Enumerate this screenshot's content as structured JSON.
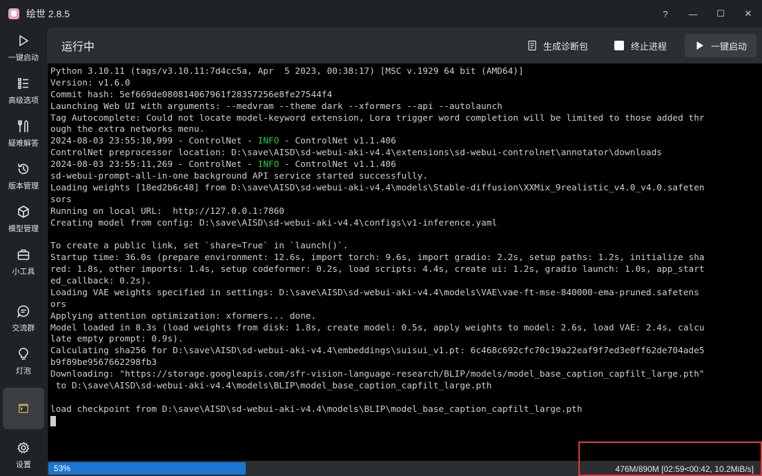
{
  "window": {
    "title": "绘世 2.8.5",
    "controls": [
      "?",
      "—",
      "☐",
      "✕"
    ]
  },
  "sidebar": {
    "items": [
      {
        "label": "一键启动",
        "icon": "play-icon"
      },
      {
        "label": "高级选项",
        "icon": "list-icon"
      },
      {
        "label": "疑难解答",
        "icon": "tools-icon"
      },
      {
        "label": "版本管理",
        "icon": "history-icon"
      },
      {
        "label": "模型管理",
        "icon": "cube-icon"
      },
      {
        "label": "小工具",
        "icon": "toolbox-icon"
      },
      {
        "label": "交流群",
        "icon": "chat-icon"
      },
      {
        "label": "灯泡",
        "icon": "bulb-icon"
      },
      {
        "label": "",
        "icon": "console-icon",
        "active": true
      },
      {
        "label": "设置",
        "icon": "gear-icon"
      }
    ]
  },
  "header": {
    "title": "运行中",
    "diagnose_label": "生成诊断包",
    "terminate_label": "终止进程",
    "launch_label": "一键启动"
  },
  "console": {
    "lines": [
      "Python 3.10.11 (tags/v3.10.11:7d4cc5a, Apr  5 2023, 00:38:17) [MSC v.1929 64 bit (AMD64)]",
      "Version: v1.6.0",
      "Commit hash: 5ef669de080814067961f28357256e8fe27544f4",
      "Launching Web UI with arguments: --medvram --theme dark --xformers --api --autolaunch",
      "Tag Autocomplete: Could not locate model-keyword extension, Lora trigger word completion will be limited to those added thr",
      "ough the extra networks menu.",
      "2024-08-03 23:55:10,999 - ControlNet - INFO - ControlNet v1.1.406",
      "ControlNet preprocessor location: D:\\save\\AISD\\sd-webui-aki-v4.4\\extensions\\sd-webui-controlnet\\annotator\\downloads",
      "2024-08-03 23:55:11,269 - ControlNet - INFO - ControlNet v1.1.406",
      "sd-webui-prompt-all-in-one background API service started successfully.",
      "Loading weights [18ed2b6c48] from D:\\save\\AISD\\sd-webui-aki-v4.4\\models\\Stable-diffusion\\XXMix_9realistic_v4.0_v4.0.safeten",
      "sors",
      "Running on local URL:  http://127.0.0.1:7860",
      "Creating model from config: D:\\save\\AISD\\sd-webui-aki-v4.4\\configs\\v1-inference.yaml",
      "",
      "To create a public link, set `share=True` in `launch()`.",
      "Startup time: 36.0s (prepare environment: 12.6s, import torch: 9.6s, import gradio: 2.2s, setup paths: 1.2s, initialize sha",
      "red: 1.8s, other imports: 1.4s, setup codeformer: 0.2s, load scripts: 4.4s, create ui: 1.2s, gradio launch: 1.0s, app_start",
      "ed_callback: 0.2s).",
      "Loading VAE weights specified in settings: D:\\save\\AISD\\sd-webui-aki-v4.4\\models\\VAE\\vae-ft-mse-840000-ema-pruned.safetens",
      "ors",
      "Applying attention optimization: xformers... done.",
      "Model loaded in 8.3s (load weights from disk: 1.8s, create model: 0.5s, apply weights to model: 2.6s, load VAE: 2.4s, calcu",
      "late empty prompt: 0.9s).",
      "Calculating sha256 for D:\\save\\AISD\\sd-webui-aki-v4.4\\embeddings\\suisui_v1.pt: 6c468c692cfc70c19a22eaf9f7ed3e0ff62de704ade5",
      "b9f89be9567662298fb3",
      "Downloading: \"https://storage.googleapis.com/sfr-vision-language-research/BLIP/models/model_base_caption_capfilt_large.pth\"",
      " to D:\\save\\AISD\\sd-webui-aki-v4.4\\models\\BLIP\\model_base_caption_capfilt_large.pth",
      "",
      "load checkpoint from D:\\save\\AISD\\sd-webui-aki-v4.4\\models\\BLIP\\model_base_caption_capfilt_large.pth"
    ],
    "info_tag": "INFO",
    "info_color": "#28c840"
  },
  "status": {
    "progress_text": "53%",
    "progress_value": 0.53,
    "progress_detail": "476M/890M [02:59<00:42, 10.2MiB/s]",
    "accent": "#1976d2",
    "highlight_color": "#e33b3b"
  }
}
